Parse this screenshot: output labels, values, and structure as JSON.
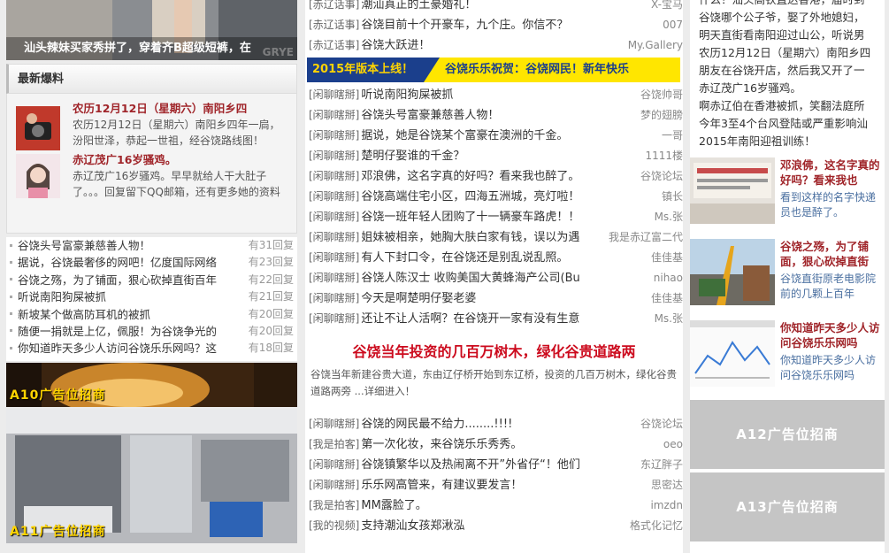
{
  "left": {
    "top_photo_caption": "汕头辣妹买家秀拼了，穿着齐B超级短裤，在",
    "top_photo_watermark": "GRYE",
    "breaking_title": "最新爆料",
    "breaking": [
      {
        "title": "农历12月12日（星期六）南阳乡四",
        "desc": "农历12月12日（星期六）南阳乡四年一扃，汾阳世泽，恭起一世祖，经谷饶路线图！"
      },
      {
        "title": "赤辽茂广16岁骚鸡。",
        "desc": "赤辽茂广16岁骚鸡。早早就给人干大肚子了。。。回复留下QQ邮箱，还有更多她的资料"
      }
    ],
    "hot_list": [
      {
        "text": "谷饶头号富豪兼慈善人物！",
        "count": "有31回复"
      },
      {
        "text": "据说，谷饶最奢侈的网吧！亿度国际网络",
        "count": "有23回复"
      },
      {
        "text": "谷饶之殇，为了铺面，狠心砍掉直街百年",
        "count": "有22回复"
      },
      {
        "text": "听说南阳狗屎被抓",
        "count": "有21回复"
      },
      {
        "text": "新坡某个做高防耳机的被抓",
        "count": "有20回复"
      },
      {
        "text": "随便一捐就是上亿，佩服！为谷饶争光的",
        "count": "有20回复"
      },
      {
        "text": "你知道昨天多少人访问谷饶乐乐网吗？这",
        "count": "有18回复"
      }
    ],
    "ad_a10": "A10广告位招商",
    "ad_a11": "A11广告位招商"
  },
  "mid": {
    "top_posts": [
      {
        "tag": "[赤辽话事]",
        "title": "潮汕真正的土豪婚礼！",
        "author": "X-宝马"
      },
      {
        "tag": "[赤辽话事]",
        "title": "谷饶目前十个开豪车，九个庄。你信不？",
        "author": "007"
      },
      {
        "tag": "[赤辽话事]",
        "title": "谷饶大跃进！",
        "author": "My.Gallery"
      }
    ],
    "banner_left": "2015年版本上线！",
    "banner_right": "谷饶乐乐祝贺：谷饶网民！新年快乐",
    "posts": [
      {
        "tag": "[闲聊瞎掰]",
        "title": "听说南阳狗屎被抓",
        "author": "谷饶帅哥"
      },
      {
        "tag": "[闲聊瞎掰]",
        "title": "谷饶头号富豪兼慈善人物！",
        "author": "梦的翅膀"
      },
      {
        "tag": "[闲聊瞎掰]",
        "title": "据说，她是谷饶某个富豪在澳洲的千金。",
        "author": "一哥"
      },
      {
        "tag": "[闲聊瞎掰]",
        "title": "楚明仔娶谁的千金？",
        "author": "1111楼"
      },
      {
        "tag": "[闲聊瞎掰]",
        "title": "邓浪佛，这名字真的好吗？看来我也醉了。",
        "author": "谷饶论坛"
      },
      {
        "tag": "[闲聊瞎掰]",
        "title": "谷饶高端住宅小区，四海五洲城，亮灯啦！",
        "author": "镇长"
      },
      {
        "tag": "[闲聊瞎掰]",
        "title": "谷饶一班年轻人团购了十一辆豪车路虎！！",
        "author": "Ms.张"
      },
      {
        "tag": "[闲聊瞎掰]",
        "title": "姐妹被相亲，她胸大肤白家有钱，误以为遇",
        "author": "我是赤辽富二代"
      },
      {
        "tag": "[闲聊瞎掰]",
        "title": "有人下封口令，在谷饶还是别乱说乱照。",
        "author": "佳佳基"
      },
      {
        "tag": "[闲聊瞎掰]",
        "title": "谷饶人陈汉士 收购美国大黄蜂海产公司(Bu",
        "author": "nihao"
      },
      {
        "tag": "[闲聊瞎掰]",
        "title": "今天是啊楚明仔娶老婆",
        "author": "佳佳基"
      },
      {
        "tag": "[闲聊瞎掰]",
        "title": "还让不让人活啊？在谷饶开一家有没有生意",
        "author": "Ms.张"
      }
    ],
    "headline": "谷饶当年投资的几百万树木，绿化谷贵道路两",
    "summary": "谷饶当年新建谷贵大道，东由辽仔桥开始到东辽桥，投资的几百万树木，绿化谷贵道路两旁 ...详细进入！",
    "bottom_posts": [
      {
        "tag": "[闲聊瞎掰]",
        "title": "谷饶的网民最不给力........!!!!",
        "author": "谷饶论坛"
      },
      {
        "tag": "[我是拍客]",
        "title": "第一次化妆，来谷饶乐乐秀秀。",
        "author": "oeo"
      },
      {
        "tag": "[闲聊瞎掰]",
        "title": "谷饶镇繁华以及热闹离不开”外省仔“！他们",
        "author": "东辽胖子"
      },
      {
        "tag": "[闲聊瞎掰]",
        "title": "乐乐网高管来，有建议要发言！",
        "author": "思密达"
      },
      {
        "tag": "[我是拍客]",
        "title": "MM露脸了。",
        "author": "imzdn"
      },
      {
        "tag": "[我的视频]",
        "title": "支持潮汕女孩郑湫泓",
        "author": "格式化记忆"
      }
    ]
  },
  "right": {
    "list": [
      "什么！汕头高铁直达香港，届时到",
      "谷饶哪个公子爷，娶了外地媳妇，",
      "明天直街看南阳迎过山公，听说男",
      "农历12月12日（星期六）南阳乡四",
      "朋友在谷饶开店，然后我又开了一",
      "赤辽茂广16岁骚鸡。",
      "啊赤辽伯在香港被抓，笑翻法庭所",
      "今年3至4个台风登陆或严重影响汕",
      "2015年南阳迎祖训练！"
    ],
    "features": [
      {
        "title": "邓浪佛，这名字真的好吗？看来我也",
        "desc": "看到这样的名字快递员也是醉了。"
      },
      {
        "title": "谷饶之殇，为了铺面，狠心砍掉直街",
        "desc": "谷饶直街原老电影院前的几颗上百年"
      },
      {
        "title": "你知道昨天多少人访问谷饶乐乐网吗",
        "desc": "你知道昨天多少人访问谷饶乐乐网吗"
      }
    ],
    "ad_a12": "A12广告位招商",
    "ad_a13": "A13广告位招商"
  }
}
